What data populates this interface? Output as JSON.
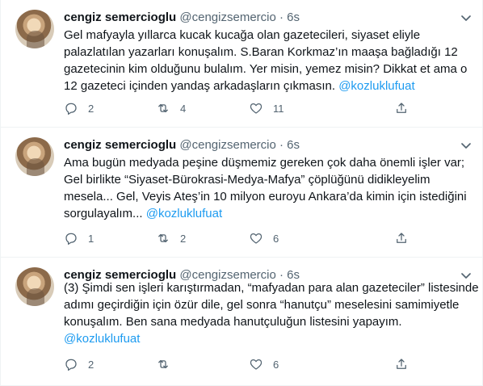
{
  "tweets": [
    {
      "author_name": "cengiz semercioglu",
      "handle": "@cengizsemercio",
      "separator": "·",
      "time": "6s",
      "text_lines": [
        "Gel mafyayla yıllarca kucak kucağa olan gazetecileri, siyaset eliyle",
        "palazlatılan yazarları konuşalım. S.Baran Korkmaz’ın maaşa bağladığı 12",
        "gazetecinin kim olduğunu bulalım. Yer misin, yemez misin? Dikkat et ama o",
        "12 gazeteci içinden yandaş arkadaşların çıkmasın. "
      ],
      "mention": "@kozluklufuat",
      "reply_count": "2",
      "retweet_count": "4",
      "like_count": "11"
    },
    {
      "author_name": "cengiz semercioglu",
      "handle": "@cengizsemercio",
      "separator": "·",
      "time": "6s",
      "text_lines": [
        "Ama bugün medyada peşine düşmemiz gereken çok  daha önemli işler var;",
        "Gel birlikte “Siyaset-Bürokrasi-Medya-Mafya” çöplüğünü didikleyelim",
        "mesela...  Gel, Veyis Ateş’in 10 milyon euroyu Ankara’da kimin için istediğini",
        "sorgulayalım... "
      ],
      "mention": "@kozluklufuat",
      "reply_count": "1",
      "retweet_count": "2",
      "like_count": "6"
    },
    {
      "author_name": "cengiz semercioglu",
      "handle": "@cengizsemercio",
      "separator": "·",
      "time": "6s",
      "text_lines": [
        "(3) Şimdi sen işleri karıştırmadan, “mafyadan para alan gazeteciler” listesinde",
        "adımı geçirdiğin için özür dile, gel sonra “hanutçu” meselesini samimiyetle",
        "konuşalım. Ben sana medyada hanutçuluğun listesini yapayım.",
        ""
      ],
      "mention": "@kozluklufuat",
      "reply_count": "2",
      "retweet_count": "",
      "like_count": "6"
    }
  ],
  "icons": {
    "reply": "reply-icon",
    "retweet": "retweet-icon",
    "like": "heart-icon",
    "share": "share-icon",
    "more": "more-options-icon"
  },
  "colors": {
    "text": "#0f1419",
    "secondary": "#536471",
    "link": "#1d9bf0",
    "divider": "#eff3f4"
  }
}
